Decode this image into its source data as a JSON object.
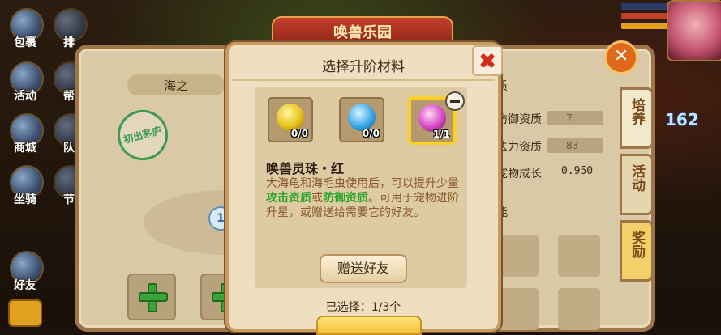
{
  "left_menu": [
    {
      "label": "包裹",
      "icon": "bag-icon"
    },
    {
      "label": "排",
      "icon": "rank-icon"
    },
    {
      "label": "活动",
      "icon": "event-icon"
    },
    {
      "label": "帮",
      "icon": "guild-icon"
    },
    {
      "label": "商城",
      "icon": "shop-icon"
    },
    {
      "label": "队",
      "icon": "team-icon"
    },
    {
      "label": "坐骑",
      "icon": "mount-icon"
    },
    {
      "label": "节",
      "icon": "festival-icon"
    },
    {
      "label": "好友",
      "icon": "friends-icon"
    }
  ],
  "banner": {
    "title": "唤兽乐园"
  },
  "back_panel": {
    "pet_name": "海之",
    "seal_text": "初出茅庐",
    "star_level": "1",
    "stats": [
      {
        "label": "质",
        "value": ""
      },
      {
        "label": "防御资质",
        "value": "7"
      },
      {
        "label": "法力资质",
        "value": "83"
      },
      {
        "label": "宠物成长",
        "value": "0.950"
      }
    ],
    "skill_label": "能",
    "tabs": [
      {
        "label": "培养",
        "active": true
      },
      {
        "label": "活动",
        "active": false
      },
      {
        "label": "奖励",
        "active": false
      }
    ]
  },
  "level_display": "162",
  "modal": {
    "title": "选择升阶材料",
    "materials": [
      {
        "count": "0/0",
        "color": "#e6c21a",
        "icon": "yellow-orb-icon",
        "selected": false
      },
      {
        "count": "0/0",
        "color": "#3aa6e6",
        "icon": "blue-orb-icon",
        "selected": false
      },
      {
        "count": "1/1",
        "color": "#d646c2",
        "icon": "red-orb-icon",
        "selected": true
      }
    ],
    "item_name": "唤兽灵珠・红",
    "description": {
      "part1": "大海龟和海毛虫使用后，可以提升少量",
      "highlight1": "攻击资质",
      "part2": "或",
      "highlight2": "防御资质",
      "part3": "。可用于宠物进阶升星，或赠送给需要它的好友。"
    },
    "gift_button": "赠送好友",
    "selected_text": "已选择：1/3个"
  }
}
